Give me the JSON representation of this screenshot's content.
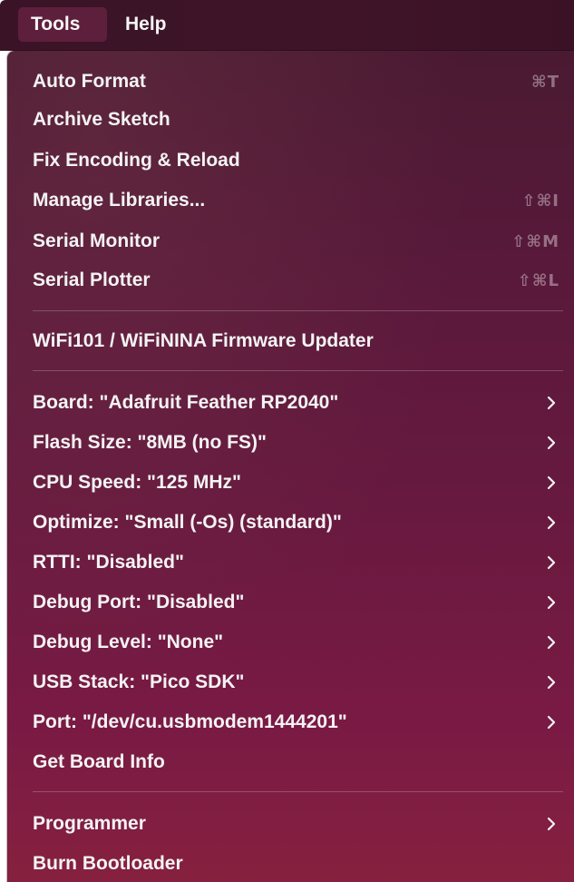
{
  "menubar": {
    "tools_label": "Tools",
    "help_label": "Help"
  },
  "menu": {
    "items": [
      {
        "label": "Auto Format",
        "shortcut": "⌘T"
      },
      {
        "label": "Archive Sketch",
        "shortcut": ""
      },
      {
        "label": "Fix Encoding & Reload",
        "shortcut": ""
      },
      {
        "label": "Manage Libraries...",
        "shortcut": "⇧⌘I"
      },
      {
        "label": "Serial Monitor",
        "shortcut": "⇧⌘M"
      },
      {
        "label": "Serial Plotter",
        "shortcut": "⇧⌘L"
      },
      {
        "label": "WiFi101 / WiFiNINA Firmware Updater"
      },
      {
        "label": "Board: \"Adafruit Feather RP2040\"",
        "submenu": true
      },
      {
        "label": "Flash Size: \"8MB (no FS)\"",
        "submenu": true
      },
      {
        "label": "CPU Speed: \"125 MHz\"",
        "submenu": true
      },
      {
        "label": "Optimize: \"Small (-Os) (standard)\"",
        "submenu": true
      },
      {
        "label": "RTTI: \"Disabled\"",
        "submenu": true
      },
      {
        "label": "Debug Port: \"Disabled\"",
        "submenu": true
      },
      {
        "label": "Debug Level: \"None\"",
        "submenu": true
      },
      {
        "label": "USB Stack: \"Pico SDK\"",
        "submenu": true
      },
      {
        "label": "Port: \"/dev/cu.usbmodem1444201\"",
        "submenu": true
      },
      {
        "label": "Get Board Info"
      },
      {
        "label": "Programmer",
        "submenu": true
      },
      {
        "label": "Burn Bootloader"
      }
    ]
  },
  "colors": {
    "menubar_bg": "#3f1429",
    "highlight_bg": "#5e1f3d",
    "menu_text": "#f3f3f3",
    "shortcut_text": "#9a7f8b"
  }
}
